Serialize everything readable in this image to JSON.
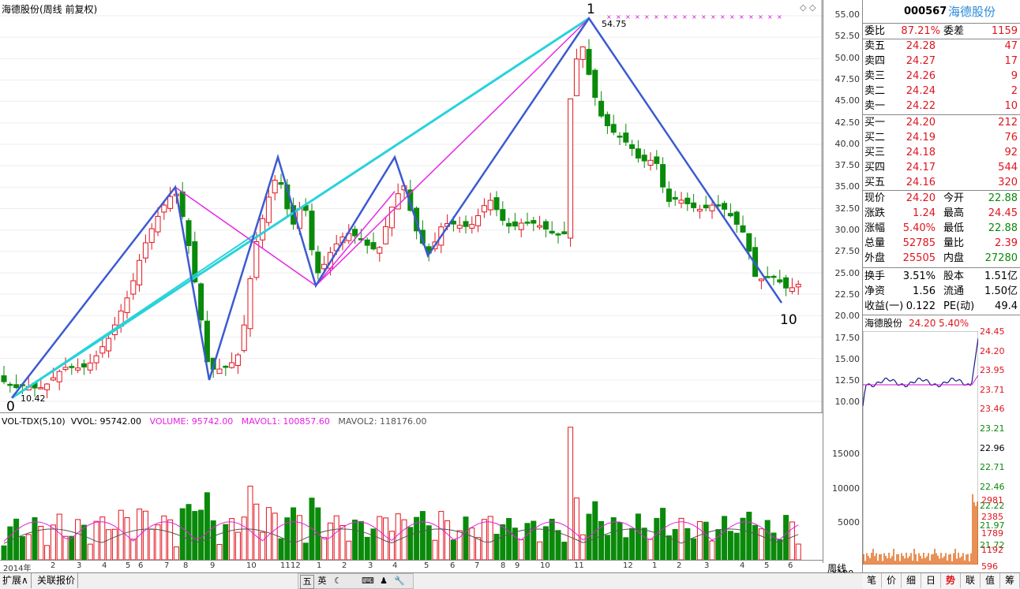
{
  "chart_header": {
    "title": "海德股份(周线 前复权)"
  },
  "main_annotations": {
    "peak_count": "1",
    "peak_value": "54.75",
    "low_count": "0",
    "low_value": "10.42",
    "end_count": "10"
  },
  "y_axis_main": [
    "55.00",
    "52.50",
    "50.00",
    "47.50",
    "45.00",
    "42.50",
    "40.00",
    "37.50",
    "35.00",
    "32.50",
    "30.00",
    "27.50",
    "25.00",
    "22.50",
    "20.00",
    "17.50",
    "15.00",
    "12.50",
    "10.00"
  ],
  "y_axis_vol": [
    "15000",
    "10000",
    "5000"
  ],
  "vol_header": {
    "name": "VOL-TDX(5,10)",
    "vvol": "VVOL: 95742.00",
    "volume": "VOLUME: 95742.00",
    "mavol1": "MAVOL1: 100857.60",
    "mavol2": "MAVOL2: 118176.00"
  },
  "x_axis": [
    "2014年",
    "2",
    "3",
    "4",
    "5",
    "6",
    "7",
    "8",
    "9",
    "10",
    "11",
    "12",
    "1",
    "2",
    "3",
    "4",
    "5",
    "6",
    "7",
    "8",
    "9",
    "10",
    "11",
    "12",
    "1",
    "2",
    "3",
    "4",
    "5",
    "6"
  ],
  "x_unit": "X100",
  "period_label": "周线",
  "bottom_tabs": [
    "扩展∧",
    "关联报价"
  ],
  "toolbar": [
    "五",
    "英",
    "☾",
    "⌨",
    "♟",
    "🔧"
  ],
  "quote": {
    "code": "000567",
    "name": "海德股份",
    "webi_label": "委比",
    "webi": "87.21%",
    "weicha_label": "委差",
    "weicha": "1159",
    "sell": [
      {
        "label": "卖五",
        "price": "24.28",
        "vol": "47"
      },
      {
        "label": "卖四",
        "price": "24.27",
        "vol": "17"
      },
      {
        "label": "卖三",
        "price": "24.26",
        "vol": "9"
      },
      {
        "label": "卖二",
        "price": "24.24",
        "vol": "2"
      },
      {
        "label": "卖一",
        "price": "24.22",
        "vol": "10"
      }
    ],
    "buy": [
      {
        "label": "买一",
        "price": "24.20",
        "vol": "212"
      },
      {
        "label": "买二",
        "price": "24.19",
        "vol": "76"
      },
      {
        "label": "买三",
        "price": "24.18",
        "vol": "92"
      },
      {
        "label": "买四",
        "price": "24.17",
        "vol": "544"
      },
      {
        "label": "买五",
        "price": "24.16",
        "vol": "320"
      }
    ],
    "stats": [
      {
        "l1": "现价",
        "v1": "24.20",
        "c1": "red",
        "l2": "今开",
        "v2": "22.88",
        "c2": "grn"
      },
      {
        "l1": "涨跌",
        "v1": "1.24",
        "c1": "red",
        "l2": "最高",
        "v2": "24.45",
        "c2": "red"
      },
      {
        "l1": "涨幅",
        "v1": "5.40%",
        "c1": "red",
        "l2": "最低",
        "v2": "22.88",
        "c2": "grn"
      },
      {
        "l1": "总量",
        "v1": "52785",
        "c1": "red",
        "l2": "量比",
        "v2": "2.39",
        "c2": "red"
      },
      {
        "l1": "外盘",
        "v1": "25505",
        "c1": "red",
        "l2": "内盘",
        "v2": "27280",
        "c2": "grn"
      }
    ],
    "stats2": [
      {
        "l1": "换手",
        "v1": "3.51%",
        "l2": "股本",
        "v2": "1.51亿"
      },
      {
        "l1": "净资",
        "v1": "1.56",
        "l2": "流通",
        "v2": "1.50亿"
      },
      {
        "l1": "收益(一)",
        "v1": "0.122",
        "l2": "PE(动)",
        "v2": "49.4"
      }
    ],
    "mini_title": "海德股份",
    "mini_price": "24.20",
    "mini_pct": "5.40%",
    "mini_prices": [
      "24.45",
      "24.20",
      "23.95",
      "23.71",
      "23.46",
      "23.21",
      "22.96",
      "22.71",
      "22.46",
      "22.22",
      "21.97",
      "21.72"
    ],
    "mini_vols": [
      "2981",
      "2385",
      "1789",
      "1192",
      "596"
    ]
  },
  "right_tabs": [
    "笔",
    "价",
    "细",
    "日",
    "势",
    "联",
    "值",
    "筹"
  ],
  "colors": {
    "up": "#e0141e",
    "down": "#0a8a0a",
    "ma1": "#e61ee6",
    "ma2": "#555555",
    "trend_blue": "#3c5ad2",
    "trend_cyan": "#28d2dc",
    "trend_magenta": "#e628e6"
  }
}
